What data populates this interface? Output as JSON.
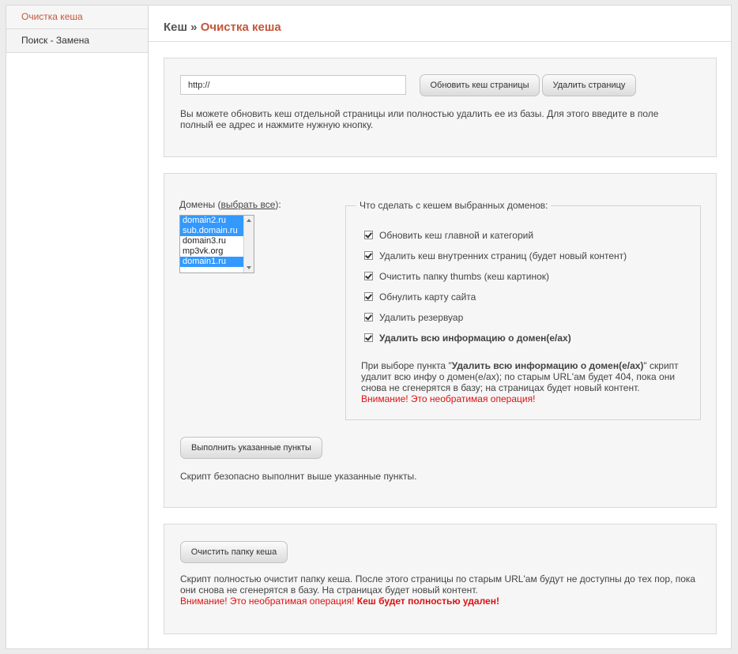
{
  "sidebar": {
    "items": [
      {
        "label": "Очистка кеша",
        "active": true
      },
      {
        "label": "Поиск - Замена",
        "active": false
      }
    ]
  },
  "header": {
    "prefix": "Кеш",
    "separator": " » ",
    "current": "Очистка кеша"
  },
  "page_cache": {
    "url_value": "http://",
    "refresh_label": "Обновить кеш страницы",
    "delete_label": "Удалить страницу",
    "description": "Вы можете обновить кеш отдельной страницы или полностью удалить ее из базы. Для этого введите в поле полный ее адрес и нажмите нужную кнопку."
  },
  "domains": {
    "label_before": "Домены (",
    "select_all_link": "выбрать все",
    "label_after": "):",
    "options": [
      {
        "name": "domain2.ru",
        "selected": true
      },
      {
        "name": "sub.domain.ru",
        "selected": true
      },
      {
        "name": "domain3.ru",
        "selected": false
      },
      {
        "name": "mp3vk.org",
        "selected": false
      },
      {
        "name": "domain1.ru",
        "selected": true
      }
    ]
  },
  "actions": {
    "legend": "Что сделать с кешем выбранных доменов:",
    "checkboxes": [
      {
        "label": "Обновить кеш главной и категорий",
        "checked": true
      },
      {
        "label": "Удалить кеш внутренних страниц (будет новый контент)",
        "checked": true
      },
      {
        "label": "Очистить папку thumbs (кеш картинок)",
        "checked": true
      },
      {
        "label": "Обнулить карту сайта",
        "checked": true
      },
      {
        "label": "Удалить резервуар",
        "checked": true
      },
      {
        "label": "Удалить всю информацию о домен(е/ах)",
        "checked": true
      }
    ],
    "note_before": "При выборе пункта \"",
    "note_bold": "Удалить всю информацию о домен(е/ах)",
    "note_after": "\" скрипт удалит всю инфу о домен(е/ах); по старым URL'ам будет 404, пока они снова не сгенерятся в базу; на страницах будет новый контент.",
    "note_warning": "Внимание! Это необратимая операция!",
    "run_label": "Выполнить указанные пункты",
    "run_description": "Скрипт безопасно выполнит выше указанные пункты."
  },
  "clear_folder": {
    "button_label": "Очистить папку кеша",
    "description": "Скрипт полностью очистит папку кеша. После этого страницы по старым URL'ам будут не доступны до тех пор, пока они снова не сгенерятся в базу. На страницах будет новый контент.",
    "warning": "Внимание! Это необратимая операция!",
    "warning_bold": "Кеш будет полностью удален!"
  },
  "colors": {
    "accent": "#c4563b",
    "warning": "#dd1111",
    "selection": "#3399ff"
  }
}
